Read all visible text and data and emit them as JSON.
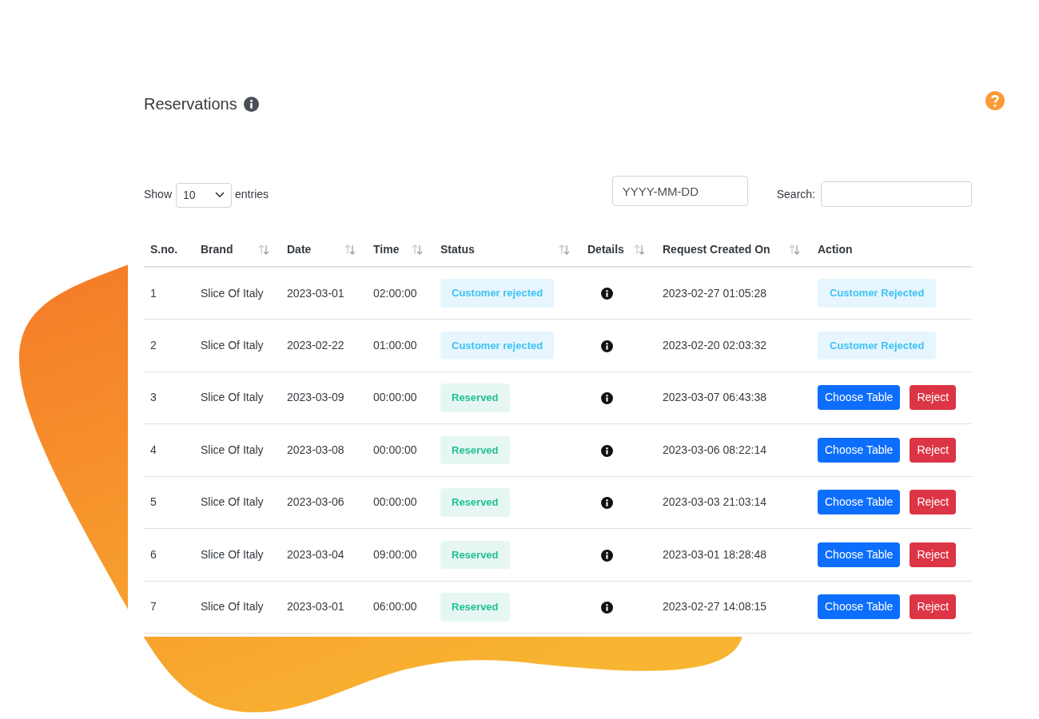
{
  "title": "Reservations",
  "length": {
    "label_before": "Show",
    "value": "10",
    "label_after": "entries"
  },
  "date_field": {
    "placeholder": "YYYY-MM-DD"
  },
  "search": {
    "label": "Search:"
  },
  "columns": [
    {
      "label": "S.no.",
      "sortable": false
    },
    {
      "label": "Brand",
      "sortable": true
    },
    {
      "label": "Date",
      "sortable": true
    },
    {
      "label": "Time",
      "sortable": true
    },
    {
      "label": "Status",
      "sortable": true
    },
    {
      "label": "Details",
      "sortable": true
    },
    {
      "label": "Request Created On",
      "sortable": true
    },
    {
      "label": "Action",
      "sortable": false
    }
  ],
  "rows": [
    {
      "sno": "1",
      "brand": "Slice Of Italy",
      "date": "2023-03-01",
      "time": "02:00:00",
      "status": {
        "kind": "rejected",
        "label": "Customer rejected"
      },
      "created": "2023-02-27 01:05:28",
      "action": {
        "kind": "label",
        "label": "Customer Rejected"
      }
    },
    {
      "sno": "2",
      "brand": "Slice Of Italy",
      "date": "2023-02-22",
      "time": "01:00:00",
      "status": {
        "kind": "rejected",
        "label": "Customer rejected"
      },
      "created": "2023-02-20 02:03:32",
      "action": {
        "kind": "label",
        "label": "Customer Rejected"
      }
    },
    {
      "sno": "3",
      "brand": "Slice Of Italy",
      "date": "2023-03-09",
      "time": "00:00:00",
      "status": {
        "kind": "reserved",
        "label": "Reserved"
      },
      "created": "2023-03-07 06:43:38",
      "action": {
        "kind": "buttons",
        "primary": "Choose Table",
        "danger": "Reject"
      }
    },
    {
      "sno": "4",
      "brand": "Slice Of Italy",
      "date": "2023-03-08",
      "time": "00:00:00",
      "status": {
        "kind": "reserved",
        "label": "Reserved"
      },
      "created": "2023-03-06 08:22:14",
      "action": {
        "kind": "buttons",
        "primary": "Choose Table",
        "danger": "Reject"
      }
    },
    {
      "sno": "5",
      "brand": "Slice Of Italy",
      "date": "2023-03-06",
      "time": "00:00:00",
      "status": {
        "kind": "reserved",
        "label": "Reserved"
      },
      "created": "2023-03-03 21:03:14",
      "action": {
        "kind": "buttons",
        "primary": "Choose Table",
        "danger": "Reject"
      }
    },
    {
      "sno": "6",
      "brand": "Slice Of Italy",
      "date": "2023-03-04",
      "time": "09:00:00",
      "status": {
        "kind": "reserved",
        "label": "Reserved"
      },
      "created": "2023-03-01 18:28:48",
      "action": {
        "kind": "buttons",
        "primary": "Choose Table",
        "danger": "Reject"
      }
    },
    {
      "sno": "7",
      "brand": "Slice Of Italy",
      "date": "2023-03-01",
      "time": "06:00:00",
      "status": {
        "kind": "reserved",
        "label": "Reserved"
      },
      "created": "2023-02-27 14:08:15",
      "action": {
        "kind": "buttons",
        "primary": "Choose Table",
        "danger": "Reject"
      }
    }
  ]
}
